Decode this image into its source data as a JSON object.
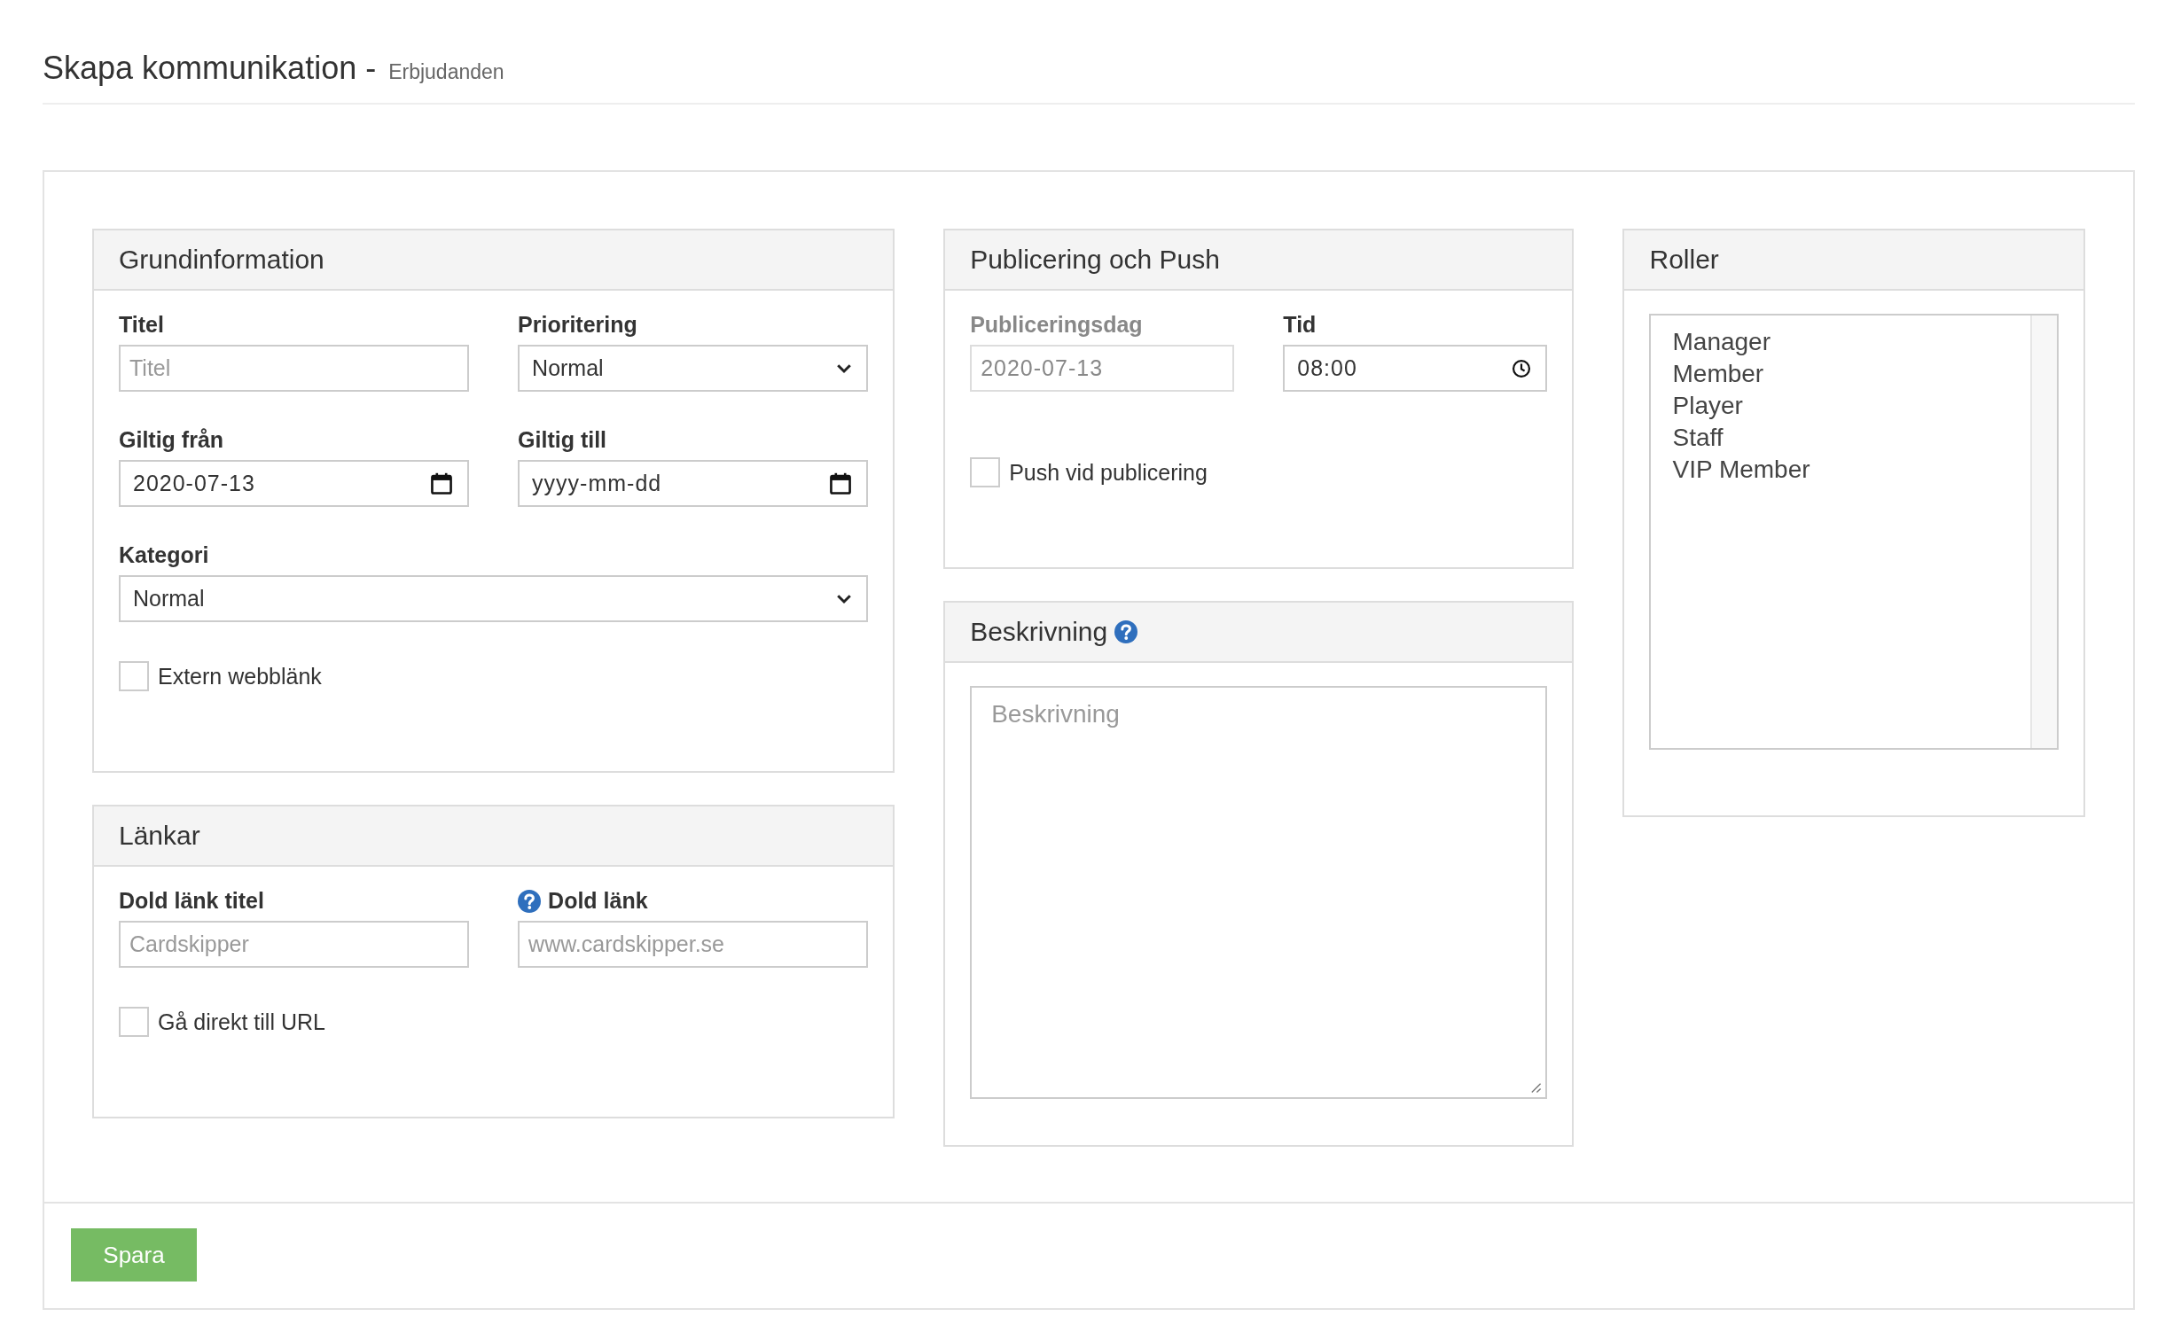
{
  "header": {
    "title": "Skapa kommunikation -",
    "subtitle": "Erbjudanden"
  },
  "columns": [
    [
      {
        "title": "Grundinformation",
        "help": false,
        "rows": [
          [
            {
              "kind": "text",
              "label": "Titel",
              "placeholder": "Titel"
            },
            {
              "kind": "select",
              "label": "Prioritering",
              "value": "Normal"
            }
          ],
          [
            {
              "kind": "date",
              "label": "Giltig från",
              "value": "2020-07-13"
            },
            {
              "kind": "date",
              "label": "Giltig till",
              "placeholder": "yyyy-mm-dd"
            }
          ],
          [
            {
              "kind": "select",
              "label": "Kategori",
              "value": "Normal"
            }
          ],
          [
            {
              "kind": "checkbox",
              "label": "Extern webblänk",
              "checked": false
            }
          ]
        ]
      },
      {
        "title": "Länkar",
        "help": false,
        "rows": [
          [
            {
              "kind": "text",
              "label": "Dold länk titel",
              "placeholder": "Cardskipper"
            },
            {
              "kind": "text",
              "label": "Dold länk",
              "help": true,
              "placeholder": "www.cardskipper.se"
            }
          ],
          [
            {
              "kind": "checkbox",
              "label": "Gå direkt till URL",
              "checked": false
            }
          ]
        ]
      }
    ],
    [
      {
        "title": "Publicering och Push",
        "help": false,
        "rows": [
          [
            {
              "kind": "text",
              "label": "Publiceringsdag",
              "value": "2020-07-13",
              "disabled": true
            },
            {
              "kind": "time",
              "label": "Tid",
              "value": "08:00"
            }
          ],
          [
            {
              "kind": "checkbox",
              "label": "Push vid publicering",
              "checked": false
            }
          ]
        ]
      },
      {
        "title": "Beskrivning",
        "help": true,
        "rows": [
          [
            {
              "kind": "textarea",
              "placeholder": "Beskrivning"
            }
          ]
        ]
      }
    ],
    [
      {
        "title": "Roller",
        "help": false,
        "rows": [
          [
            {
              "kind": "listbox",
              "options": [
                {
                  "label": "Manager",
                  "selected": false
                },
                {
                  "label": "Member",
                  "selected": false
                },
                {
                  "label": "Player",
                  "selected": false
                },
                {
                  "label": "Staff",
                  "selected": false
                },
                {
                  "label": "VIP Member",
                  "selected": false
                }
              ]
            }
          ]
        ]
      }
    ]
  ],
  "footer": {
    "button": "Spara"
  }
}
